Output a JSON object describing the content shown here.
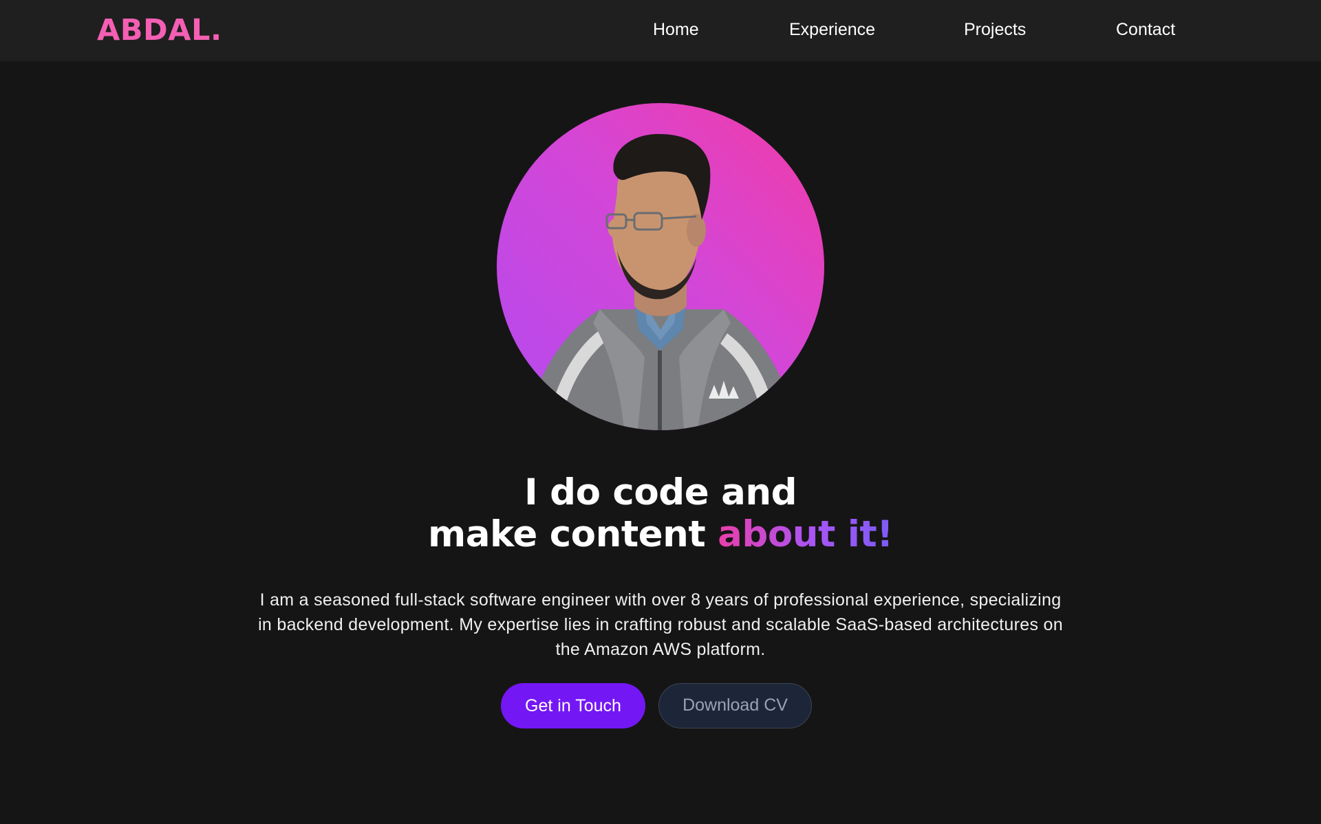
{
  "header": {
    "logo": "ABDAL.",
    "nav": [
      {
        "label": "Home"
      },
      {
        "label": "Experience"
      },
      {
        "label": "Projects"
      },
      {
        "label": "Contact"
      }
    ]
  },
  "hero": {
    "avatar_icon": "profile-photo",
    "headline_line1": "I do code and",
    "headline_line2_plain": "make content ",
    "headline_line2_accent": "about it!",
    "intro": "I am a seasoned full-stack software engineer with over 8 years of professional experience, specializing in backend development. My expertise lies in crafting robust and scalable SaaS-based architectures on the Amazon AWS platform.",
    "primary_button": "Get in Touch",
    "secondary_button": "Download CV"
  },
  "colors": {
    "background": "#161515",
    "navbar": "#1f1f1f",
    "logo": "#f45fb4",
    "primary_button": "#7417f5",
    "secondary_button": "#1d2638",
    "accent_gradient_start": "#e93fa9",
    "accent_gradient_end": "#7c5cf6"
  }
}
